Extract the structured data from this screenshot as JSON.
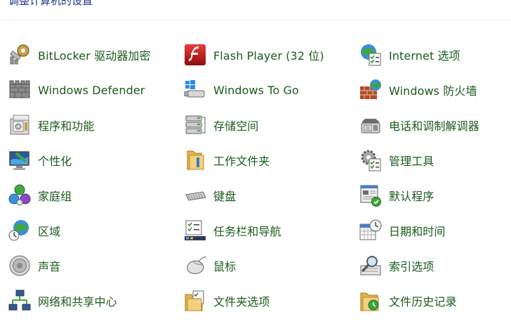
{
  "header": {
    "title": "调整计算机的设置"
  },
  "rows": [
    [
      {
        "label": "BitLocker 驱动器加密",
        "icon": "bitlocker-key-icon"
      },
      {
        "label": "Flash Player (32 位)",
        "icon": "flash-player-icon"
      },
      {
        "label": "Internet 选项",
        "icon": "internet-options-icon"
      }
    ],
    [
      {
        "label": "Windows Defender",
        "icon": "windows-defender-icon"
      },
      {
        "label": "Windows To Go",
        "icon": "windows-to-go-icon"
      },
      {
        "label": "Windows 防火墙",
        "icon": "firewall-icon"
      }
    ],
    [
      {
        "label": "程序和功能",
        "icon": "programs-features-icon"
      },
      {
        "label": "存储空间",
        "icon": "storage-spaces-icon"
      },
      {
        "label": "电话和调制解调器",
        "icon": "phone-modem-icon"
      }
    ],
    [
      {
        "label": "个性化",
        "icon": "personalization-icon"
      },
      {
        "label": "工作文件夹",
        "icon": "work-folders-icon"
      },
      {
        "label": "管理工具",
        "icon": "admin-tools-icon"
      }
    ],
    [
      {
        "label": "家庭组",
        "icon": "homegroup-icon"
      },
      {
        "label": "键盘",
        "icon": "keyboard-icon"
      },
      {
        "label": "默认程序",
        "icon": "default-programs-icon"
      }
    ],
    [
      {
        "label": "区域",
        "icon": "region-icon"
      },
      {
        "label": "任务栏和导航",
        "icon": "taskbar-navigation-icon"
      },
      {
        "label": "日期和时间",
        "icon": "date-time-icon"
      }
    ],
    [
      {
        "label": "声音",
        "icon": "sound-icon"
      },
      {
        "label": "鼠标",
        "icon": "mouse-icon"
      },
      {
        "label": "索引选项",
        "icon": "indexing-options-icon"
      }
    ],
    [
      {
        "label": "网络和共享中心",
        "icon": "network-sharing-icon"
      },
      {
        "label": "文件夹选项",
        "icon": "folder-options-icon"
      },
      {
        "label": "文件历史记录",
        "icon": "file-history-icon"
      }
    ]
  ],
  "colors": {
    "link": "#1c5a1c",
    "header": "#1e3287",
    "rule": "#e4e7ea"
  }
}
